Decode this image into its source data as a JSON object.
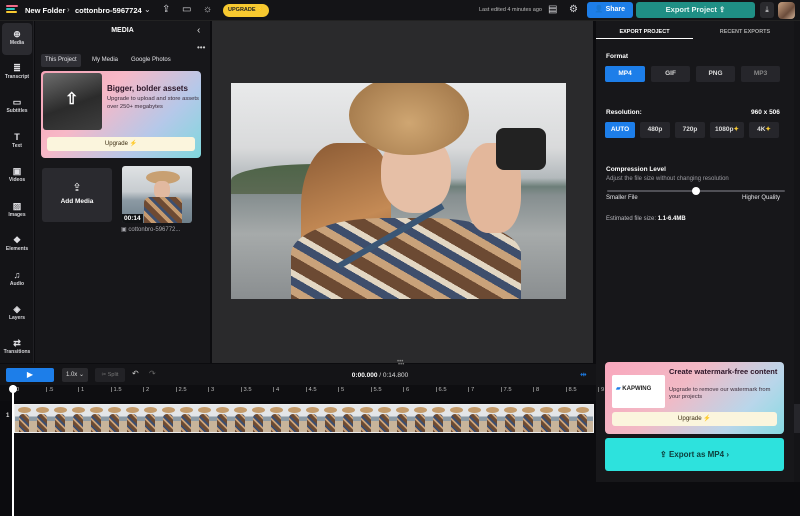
{
  "topbar": {
    "folder": "New Folder",
    "project": "cottonbro-5967724",
    "upgrade_label": "UPGRADE",
    "edited": "Last edited 4 minutes ago",
    "share_label": "Share",
    "export_label": "Export Project"
  },
  "leftnav": [
    {
      "label": "Media",
      "icon": "media-icon"
    },
    {
      "label": "Transcript",
      "icon": "transcript-icon"
    },
    {
      "label": "Subtitles",
      "icon": "subtitles-icon"
    },
    {
      "label": "Text",
      "icon": "text-icon"
    },
    {
      "label": "Videos",
      "icon": "videos-icon"
    },
    {
      "label": "Images",
      "icon": "images-icon"
    },
    {
      "label": "Elements",
      "icon": "elements-icon"
    },
    {
      "label": "Audio",
      "icon": "audio-icon"
    },
    {
      "label": "Layers",
      "icon": "layers-icon"
    },
    {
      "label": "Transitions",
      "icon": "transitions-icon"
    }
  ],
  "media": {
    "title": "MEDIA",
    "tabs": [
      "This Project",
      "My Media",
      "Google Photos"
    ],
    "promo": {
      "heading": "Bigger, bolder assets",
      "text": "Upgrade to upload and store assets over 250+ megabytes",
      "button": "Upgrade"
    },
    "add_media": "Add Media",
    "thumb": {
      "duration": "00:14",
      "name": "cottonbro-596772..."
    }
  },
  "export_panel": {
    "tabs": [
      "EXPORT PROJECT",
      "RECENT EXPORTS"
    ],
    "format_label": "Format",
    "formats": [
      "MP4",
      "GIF",
      "PNG",
      "MP3"
    ],
    "resolution_label": "Resolution:",
    "resolution_value": "960 x 506",
    "resolutions": [
      "AUTO",
      "480p",
      "720p",
      "1080p",
      "4K"
    ],
    "compression_label": "Compression Level",
    "compression_desc": "Adjust the file size without changing resolution",
    "compression_level": 0.5,
    "smaller": "Smaller File",
    "higher": "Higher Quality",
    "est_label": "Estimated file size:",
    "est_value": "1.1-6.4MB",
    "watermark": {
      "heading": "Create watermark-free content",
      "text": "Upgrade to remove our watermark from your projects",
      "brand": "KAPWING",
      "button": "Upgrade"
    },
    "export_button": "Export as MP4"
  },
  "timeline": {
    "speed": "1.0x",
    "split": "Split",
    "current_time": "0:00.000",
    "total_time": "0:14.800",
    "track_number": "1",
    "ticks": [
      "0",
      ".5",
      "1",
      "1.5",
      "2",
      "2.5",
      "3",
      "3.5",
      "4",
      "4.5",
      "5",
      "5.5",
      "6",
      "6.5",
      "7",
      "7.5",
      "8",
      "8.5",
      "9"
    ]
  },
  "colors": {
    "accent": "#1d7ee9",
    "export": "#2de2dd",
    "upgrade": "#f7c930"
  }
}
